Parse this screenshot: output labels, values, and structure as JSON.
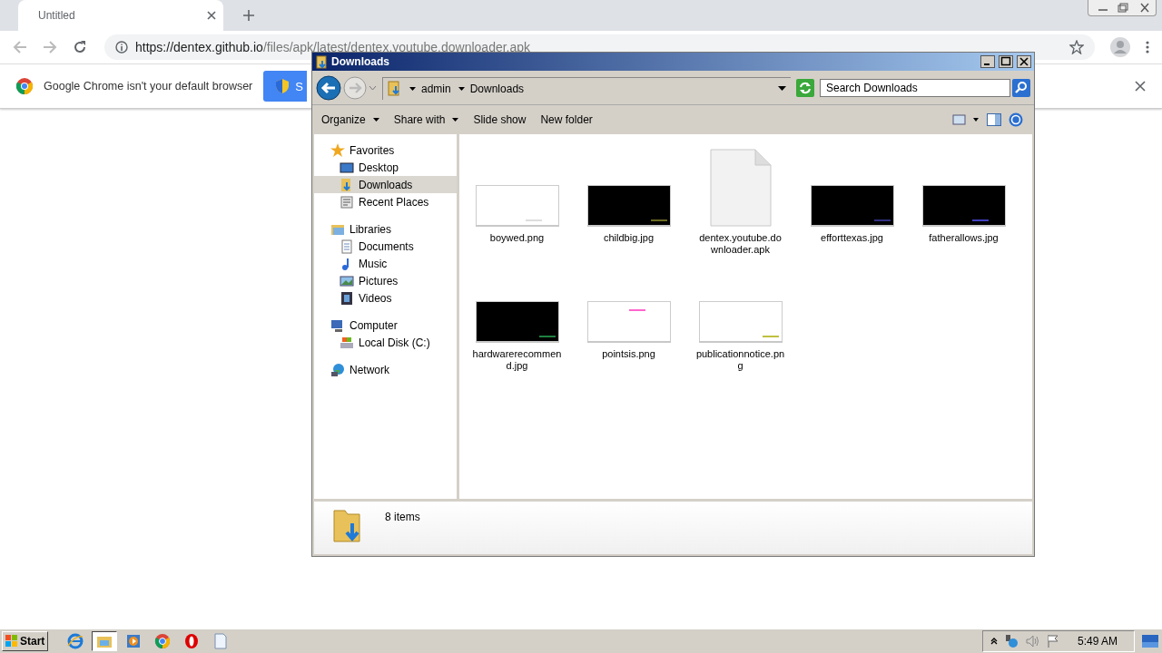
{
  "browser": {
    "tabs": [
      {
        "title": "Untitled",
        "selected": true
      }
    ],
    "url": {
      "host": "https://dentex.github.io",
      "path": "/files/apk/latest/dentex.youtube.downloader.apk"
    },
    "banner": {
      "message": "Google Chrome isn't your default browser",
      "button": "S"
    }
  },
  "explorer": {
    "title": "Downloads",
    "breadcrumb": [
      "admin",
      "Downloads"
    ],
    "search": {
      "placeholder": "Search Downloads"
    },
    "commands": [
      {
        "label": "Organize",
        "has_menu": true
      },
      {
        "label": "Share with",
        "has_menu": true
      },
      {
        "label": "Slide show",
        "has_menu": false
      },
      {
        "label": "New folder",
        "has_menu": false
      }
    ],
    "nav": [
      {
        "label": "Favorites",
        "kind": "favorites",
        "selected": false,
        "children": [
          {
            "label": "Desktop",
            "kind": "desktop",
            "selected": false
          },
          {
            "label": "Downloads",
            "kind": "downloads",
            "selected": true
          },
          {
            "label": "Recent Places",
            "kind": "recent",
            "selected": false
          }
        ]
      },
      {
        "label": "Libraries",
        "kind": "libraries",
        "selected": false,
        "children": [
          {
            "label": "Documents",
            "kind": "documents",
            "selected": false
          },
          {
            "label": "Music",
            "kind": "music",
            "selected": false
          },
          {
            "label": "Pictures",
            "kind": "pictures",
            "selected": false
          },
          {
            "label": "Videos",
            "kind": "videos",
            "selected": false
          }
        ]
      },
      {
        "label": "Computer",
        "kind": "computer",
        "selected": false,
        "children": [
          {
            "label": "Local Disk (C:)",
            "kind": "disk",
            "selected": false
          }
        ]
      },
      {
        "label": "Network",
        "kind": "network",
        "selected": false
      }
    ],
    "files": [
      {
        "name": "boywed.png",
        "kind": "picture"
      },
      {
        "name": "childbig.jpg",
        "kind": "picture"
      },
      {
        "name": "dentex.youtube.downloader.apk",
        "kind": "file"
      },
      {
        "name": "efforttexas.jpg",
        "kind": "picture"
      },
      {
        "name": "fatherallows.jpg",
        "kind": "picture"
      },
      {
        "name": "hardwarerecommend.jpg",
        "kind": "picture"
      },
      {
        "name": "pointsis.png",
        "kind": "picture"
      },
      {
        "name": "publicationnotice.png",
        "kind": "picture"
      }
    ],
    "status": "8 items"
  },
  "taskbar": {
    "start": "Start",
    "apps": [
      {
        "kind": "ie",
        "selected": false
      },
      {
        "kind": "explorer",
        "selected": true
      },
      {
        "kind": "media",
        "selected": false
      },
      {
        "kind": "chrome",
        "selected": false
      },
      {
        "kind": "opera",
        "selected": false
      },
      {
        "kind": "notepad",
        "selected": false
      }
    ],
    "clock": "5:49 AM"
  }
}
